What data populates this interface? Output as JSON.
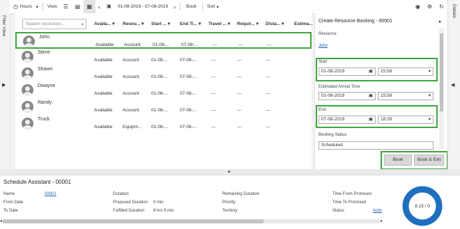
{
  "toolbar": {
    "hours_label": "Hours",
    "view_label": "View",
    "date_range": "01-08-2019 - 07-08-2019",
    "book_label": "Book",
    "sort_label": "Sort"
  },
  "rails": {
    "filter_view": "Filter View",
    "details": "Details"
  },
  "grid": {
    "search_placeholder": "Search resources...",
    "columns": [
      "Availa...",
      "Resou...",
      "Start ...",
      "End Ti...",
      "Travel ...",
      "Requir...",
      "Dista...",
      "Estima..."
    ],
    "rows": [
      {
        "name": "John",
        "availability": "Available",
        "type": "Account",
        "start": "01-08-...",
        "end": "07-08-...",
        "travel": "---",
        "req": "---",
        "dist": "---"
      },
      {
        "name": "Steve",
        "availability": "Available",
        "type": "Account",
        "start": "01-08-...",
        "end": "07-08-...",
        "travel": "---",
        "req": "---",
        "dist": "---"
      },
      {
        "name": "Shawn",
        "availability": "Available",
        "type": "Account",
        "start": "01-08-...",
        "end": "07-08-...",
        "travel": "---",
        "req": "---",
        "dist": "---"
      },
      {
        "name": "Dwayne",
        "availability": "Available",
        "type": "Account",
        "start": "01-08-...",
        "end": "07-08-...",
        "travel": "---",
        "req": "---",
        "dist": "---"
      },
      {
        "name": "Randy",
        "availability": "Available",
        "type": "Account",
        "start": "01-08-...",
        "end": "07-08-...",
        "travel": "---",
        "req": "---",
        "dist": "---"
      },
      {
        "name": "Truck",
        "availability": "Available",
        "type": "Equipm...",
        "start": "01-08-...",
        "end": "07-08-...",
        "travel": "---",
        "req": "---",
        "dist": "---"
      }
    ]
  },
  "booking": {
    "title": "Create Resource Booking - 00001",
    "resource_label": "Resource",
    "resource_value": "John",
    "start_label": "Start",
    "start_date": "01-08-2019",
    "start_time": "15:58",
    "arrival_label": "Estimated Arrival Time",
    "arrival_date": "01-08-2019",
    "arrival_time": "15:58",
    "end_label": "End",
    "end_date": "07-08-2019",
    "end_time": "18:29",
    "status_label": "Booking Status",
    "status_value": "Scheduled",
    "book_button": "Book",
    "book_exit_button": "Book & Exit"
  },
  "assistant": {
    "title": "Schedule Assistant - 00001",
    "name_label": "Name",
    "name_value": "00001",
    "from_date_label": "From Date",
    "to_date_label": "To Date",
    "duration_label": "Duration",
    "proposed_duration_label": "Proposed Duration",
    "proposed_duration_value": "0 min",
    "fulfilled_duration_label": "Fulfilled Duration",
    "fulfilled_duration_value": "8 hrs 9 min",
    "remaining_duration_label": "Remaining Duration",
    "priority_label": "Priority",
    "territory_label": "Territory",
    "time_from_promised_label": "Time From Promised",
    "time_to_promised_label": "Time To Promised",
    "status_label": "Status",
    "status_value": "Activ",
    "donut_text": "8.15 / 0"
  }
}
